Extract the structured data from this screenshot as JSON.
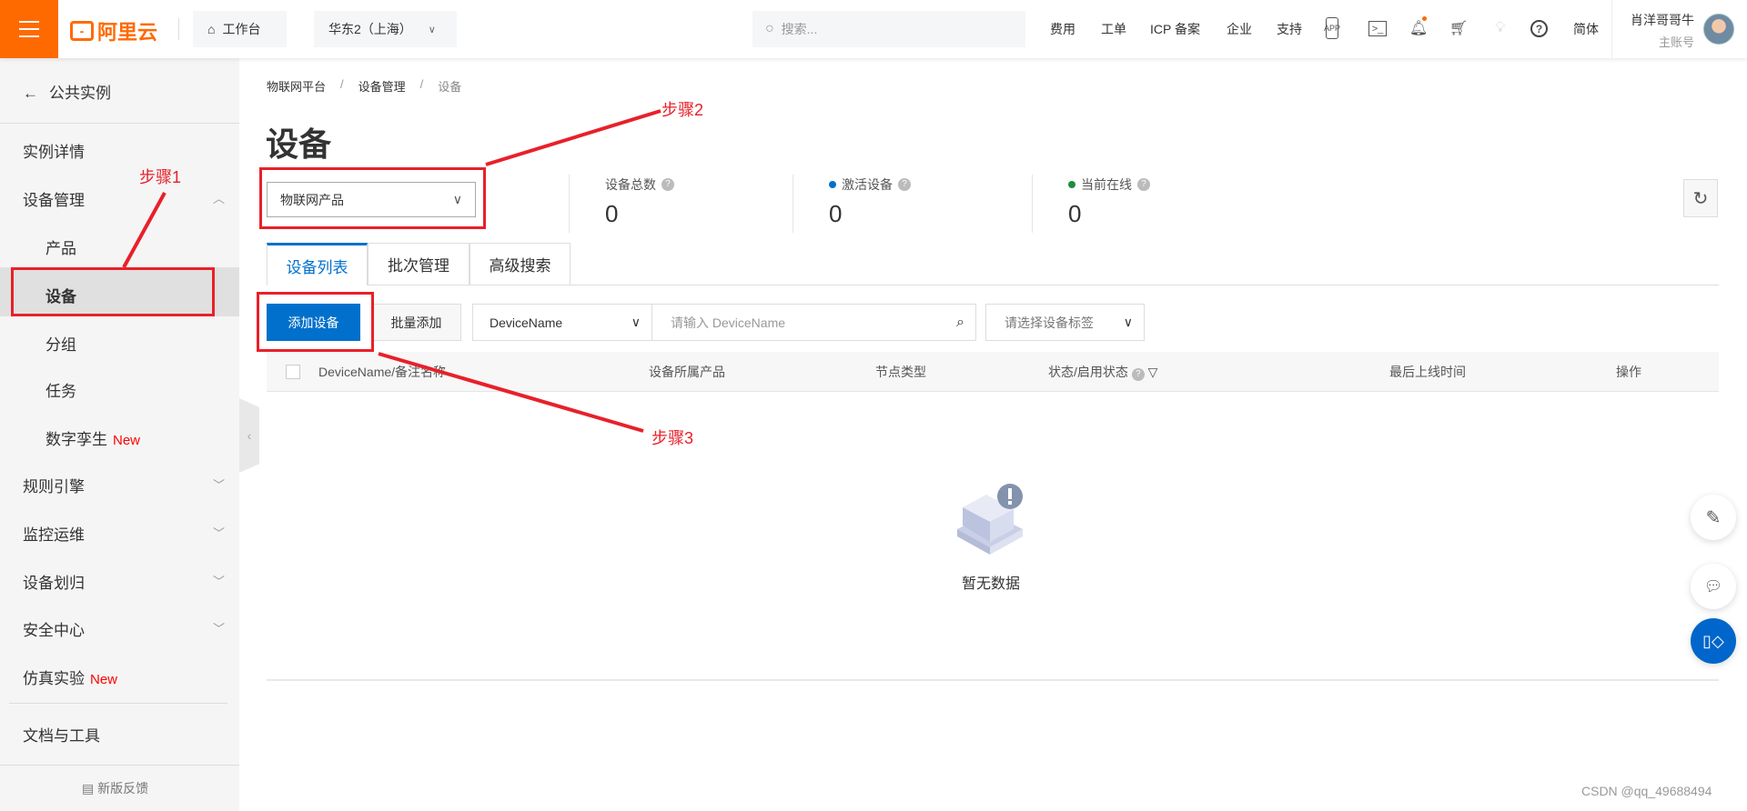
{
  "header": {
    "brand": "阿里云",
    "workbench": "工作台",
    "region": "华东2（上海）",
    "search_placeholder": "搜索...",
    "nav": [
      "费用",
      "工单",
      "ICP 备案",
      "企业",
      "支持"
    ],
    "lang": "简体",
    "user_name": "肖洋哥哥牛",
    "account_type": "主账号",
    "notification_dot_color": "#ff6a00"
  },
  "sidebar": {
    "back": "公共实例",
    "instance_detail": "实例详情",
    "device_mgmt": "设备管理",
    "product": "产品",
    "device": "设备",
    "group": "分组",
    "task": "任务",
    "digital_twin": "数字孪生",
    "new_badge": "New",
    "rule_engine": "规则引擎",
    "monitor": "监控运维",
    "device_assign": "设备划归",
    "security": "安全中心",
    "simulation": "仿真实验",
    "docs": "文档与工具",
    "feedback": "新版反馈"
  },
  "main": {
    "breadcrumb": [
      "物联网平台",
      "设备管理",
      "设备"
    ],
    "sep": "/",
    "title": "设备",
    "product_select": "物联网产品",
    "stats": [
      {
        "label": "设备总数",
        "value": "0"
      },
      {
        "label": "激活设备",
        "value": "0",
        "dot": "#0070cc"
      },
      {
        "label": "当前在线",
        "value": "0",
        "dot": "#1e8e3e"
      }
    ],
    "tabs": [
      "设备列表",
      "批次管理",
      "高级搜索"
    ],
    "add_device": "添加设备",
    "batch_add": "批量添加",
    "filter_field": "DeviceName",
    "search_placeholder": "请输入 DeviceName",
    "tag_placeholder": "请选择设备标签",
    "columns": [
      "DeviceName/备注名称",
      "设备所属产品",
      "节点类型",
      "状态/启用状态",
      "最后上线时间",
      "操作"
    ],
    "empty": "暂无数据"
  },
  "annotations": {
    "step1": "步骤1",
    "step2": "步骤2",
    "step3": "步骤3"
  },
  "watermark": "CSDN @qq_49688494",
  "colors": {
    "brand": "#ff6a00",
    "primary": "#0070cc",
    "annotation": "#e8202a"
  }
}
